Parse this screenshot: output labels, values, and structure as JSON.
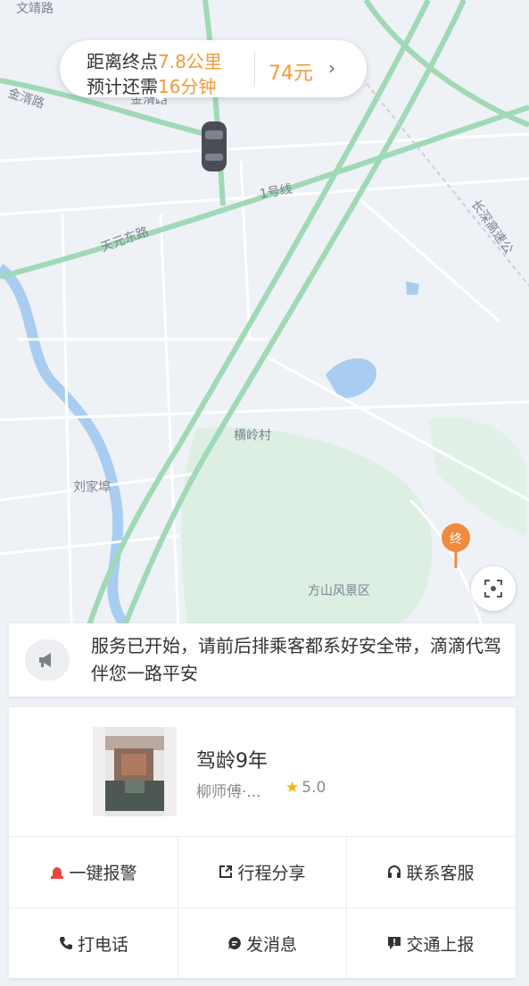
{
  "map": {
    "labels": {
      "top_left_road": "文靖路",
      "jinsu_road": "金湑路",
      "jinsu_road_2": "金湑路",
      "line1": "1号线",
      "tianyuan_road": "天元东路",
      "changshen_expressway": "长深高速公",
      "henglingcun": "横岭村",
      "liujiahan": "刘家埠",
      "fangshan": "方山风景区"
    },
    "end_marker": "终",
    "colors": {
      "road_green": "#9fd9b6",
      "park_green": "#dcefe2",
      "water": "#a9cdf0",
      "base": "#eef1f6"
    }
  },
  "trip_bubble": {
    "line1_prefix": "距离终点",
    "distance": "7.8公里",
    "line2_prefix": "预计还需",
    "duration": "16分钟",
    "fare": "74元",
    "chevron": "›"
  },
  "notice": {
    "icon": "megaphone-icon",
    "text": "服务已开始，请前后排乘客都系好安全带，滴滴代驾伴您一路平安"
  },
  "driver": {
    "experience": "驾龄9年",
    "name": "柳师傅·...",
    "rating": "5.0"
  },
  "actions": [
    {
      "label": "一键报警",
      "icon": "alarm-icon"
    },
    {
      "label": "行程分享",
      "icon": "share-icon"
    },
    {
      "label": "联系客服",
      "icon": "headset-icon"
    },
    {
      "label": "打电话",
      "icon": "phone-icon"
    },
    {
      "label": "发消息",
      "icon": "message-icon"
    },
    {
      "label": "交通上报",
      "icon": "report-icon"
    }
  ],
  "accent_color": "#f29a3c"
}
